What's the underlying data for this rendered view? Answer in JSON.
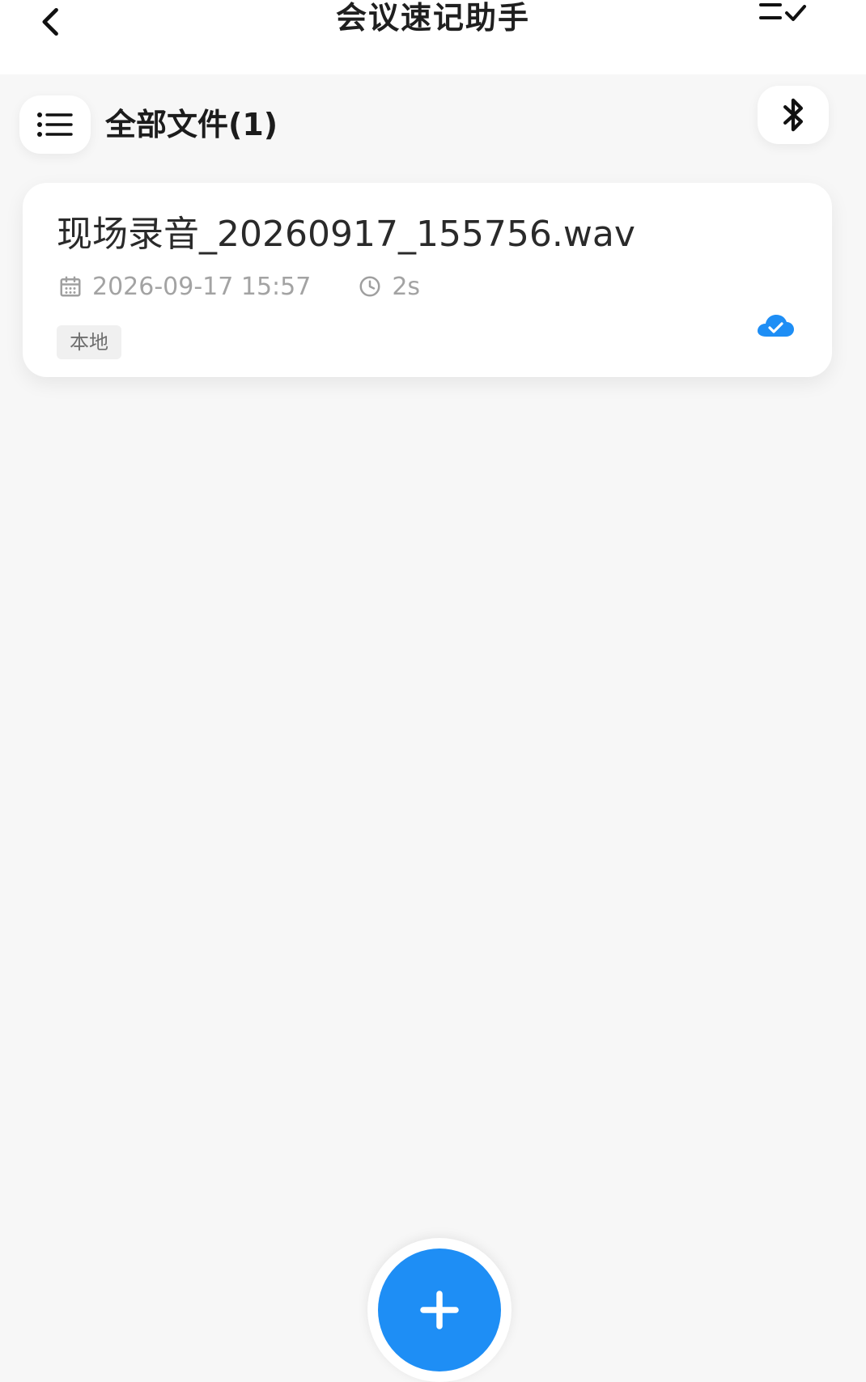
{
  "header": {
    "title": "会议速记助手"
  },
  "toolbar": {
    "folder_title": "全部文件(1)"
  },
  "files": [
    {
      "name": "现场录音_20260917_155756.wav",
      "date": "2026-09-17 15:57",
      "duration": "2s",
      "tag": "本地",
      "sync_status_icon": "cloud-check-icon"
    }
  ],
  "colors": {
    "accent": "#1e8ef5",
    "background": "#f7f7f7",
    "meta_text": "#a3a3a3"
  },
  "icons": {
    "back": "chevron-left-icon",
    "multiselect": "list-check-icon",
    "menu": "list-icon",
    "bluetooth": "bluetooth-icon",
    "calendar": "calendar-icon",
    "clock": "clock-icon",
    "add": "plus-icon"
  }
}
